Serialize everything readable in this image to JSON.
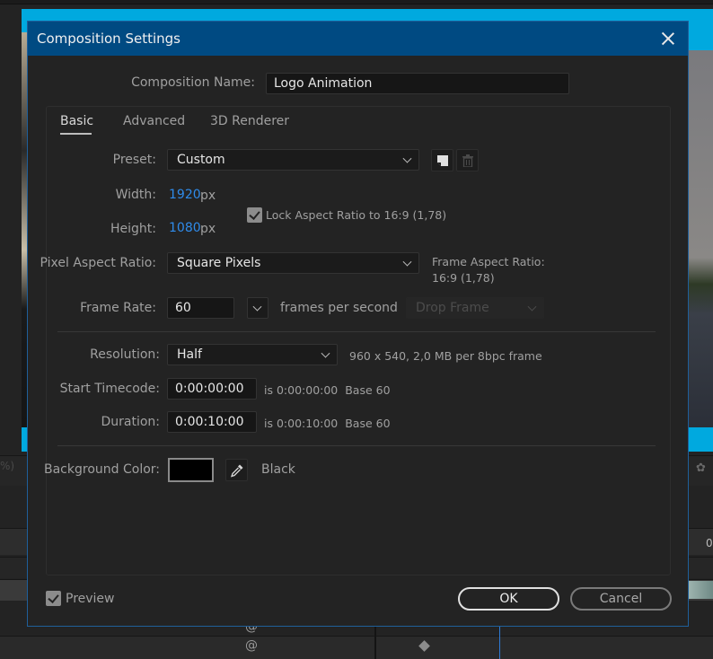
{
  "dialog": {
    "title": "Composition Settings",
    "close_icon": "close-icon",
    "composition_name_label": "Composition Name:",
    "composition_name_value": "Logo Animation",
    "tabs": [
      {
        "label": "Basic",
        "active": true
      },
      {
        "label": "Advanced",
        "active": false
      },
      {
        "label": "3D Renderer",
        "active": false
      }
    ],
    "preset": {
      "label": "Preset:",
      "value": "Custom",
      "save_icon": "save-preset-icon",
      "delete_icon": "trash-icon"
    },
    "width": {
      "label": "Width:",
      "value": "1920",
      "unit": "px"
    },
    "height": {
      "label": "Height:",
      "value": "1080",
      "unit": "px"
    },
    "lock_aspect": {
      "label": "Lock Aspect Ratio to 16:9 (1,78)",
      "checked": true
    },
    "pixel_aspect": {
      "label": "Pixel Aspect Ratio:",
      "value": "Square Pixels"
    },
    "frame_aspect": {
      "label": "Frame Aspect Ratio:",
      "value": "16:9 (1,78)"
    },
    "frame_rate": {
      "label": "Frame Rate:",
      "value": "60",
      "unit": "frames per second",
      "drop_frame": "Drop Frame"
    },
    "resolution": {
      "label": "Resolution:",
      "value": "Half",
      "info": "960 x 540, 2,0 MB per 8bpc frame"
    },
    "start_timecode": {
      "label": "Start Timecode:",
      "value": "0:00:00:00",
      "info": "is 0:00:00:00  Base 60"
    },
    "duration": {
      "label": "Duration:",
      "value": "0:00:10:00",
      "info": "is 0:00:10:00  Base 60"
    },
    "background_color": {
      "label": "Background Color:",
      "color": "#000000",
      "name": "Black",
      "eyedropper_icon": "eyedropper-icon"
    },
    "preview": {
      "label": "Preview",
      "checked": true
    },
    "buttons": {
      "ok": "OK",
      "cancel": "Cancel"
    }
  },
  "background": {
    "left_fragment": "%)",
    "right_fragment": "0",
    "accent": "#00a9df",
    "dialog_title_bg": "#004a82"
  }
}
